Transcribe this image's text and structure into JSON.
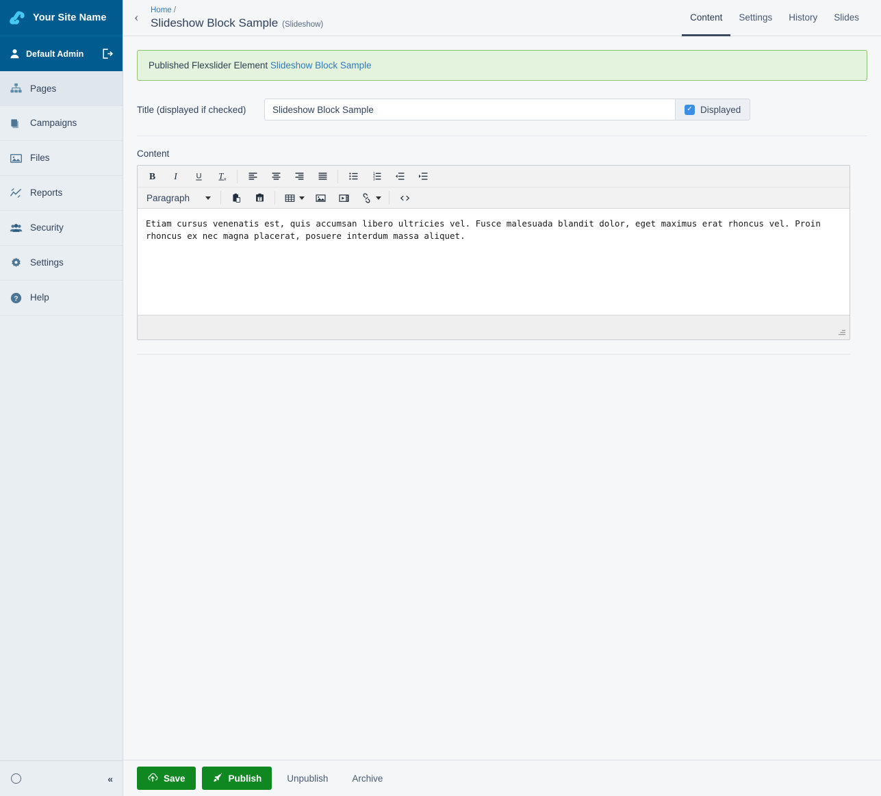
{
  "colors": {
    "brand_blue": "#005b8f",
    "sidebar_bg": "#e9eef2",
    "accent_link": "#337ab7",
    "success_bg": "#e3f3dd",
    "success_border": "#8cc474",
    "publish_green": "#0f8821",
    "checkbox_blue": "#3a8ee6"
  },
  "sidebar": {
    "brand_name": "Your Site Name",
    "logo_icon": "silverstripe-logo-icon",
    "profile": {
      "name": "Default Admin",
      "avatar_icon": "user-avatar-icon",
      "logout_icon": "logout-icon"
    },
    "items": [
      {
        "label": "Pages",
        "icon": "sitemap-icon",
        "active": true
      },
      {
        "label": "Campaigns",
        "icon": "campaigns-icon",
        "active": false
      },
      {
        "label": "Files",
        "icon": "image-icon",
        "active": false
      },
      {
        "label": "Reports",
        "icon": "chart-line-icon",
        "active": false
      },
      {
        "label": "Security",
        "icon": "users-icon",
        "active": false
      },
      {
        "label": "Settings",
        "icon": "gear-icon",
        "active": false
      },
      {
        "label": "Help",
        "icon": "question-circle-icon",
        "active": false
      }
    ],
    "footer": {
      "status_icon": "circle-icon",
      "collapse_label": "«"
    }
  },
  "topbar": {
    "back_icon": "chevron-left-icon",
    "breadcrumb_home": "Home",
    "breadcrumb_separator": "/",
    "page_title": "Slideshow Block Sample",
    "page_type": "(Slideshow)",
    "tabs": [
      {
        "label": "Content",
        "active": true
      },
      {
        "label": "Settings",
        "active": false
      },
      {
        "label": "History",
        "active": false
      },
      {
        "label": "Slides",
        "active": false
      }
    ]
  },
  "alert": {
    "text_before": "Published Flexslider Element ",
    "link_text": "Slideshow Block Sample"
  },
  "form": {
    "title_field": {
      "label": "Title (displayed if checked)",
      "value": "Slideshow Block Sample",
      "placeholder": ""
    },
    "displayed_checkbox": {
      "label": "Displayed",
      "checked": true,
      "check_glyph": "✓"
    },
    "content_label": "Content"
  },
  "editor": {
    "format_select": "Paragraph",
    "toolbar_row1": [
      {
        "name": "bold-icon",
        "title": "Bold"
      },
      {
        "name": "italic-icon",
        "title": "Italic"
      },
      {
        "name": "underline-icon",
        "title": "Underline"
      },
      {
        "name": "remove-format-icon",
        "title": "Clear formatting"
      },
      {
        "name": "align-left-icon",
        "title": "Align left"
      },
      {
        "name": "align-center-icon",
        "title": "Align center"
      },
      {
        "name": "align-right-icon",
        "title": "Align right"
      },
      {
        "name": "align-justify-icon",
        "title": "Justify"
      },
      {
        "name": "bullet-list-icon",
        "title": "Bullet list"
      },
      {
        "name": "numbered-list-icon",
        "title": "Numbered list"
      },
      {
        "name": "outdent-icon",
        "title": "Decrease indent"
      },
      {
        "name": "indent-icon",
        "title": "Increase indent"
      }
    ],
    "toolbar_row2": [
      {
        "name": "paste-icon",
        "title": "Paste"
      },
      {
        "name": "paste-as-text-icon",
        "title": "Paste as text"
      },
      {
        "name": "table-icon",
        "title": "Table"
      },
      {
        "name": "insert-image-icon",
        "title": "Insert image"
      },
      {
        "name": "insert-media-icon",
        "title": "Insert media"
      },
      {
        "name": "insert-link-icon",
        "title": "Insert link"
      },
      {
        "name": "source-code-icon",
        "title": "Source code"
      }
    ],
    "body_text": "Etiam cursus venenatis est, quis accumsan libero ultricies vel. Fusce malesuada blandit dolor, eget maximus erat rhoncus vel. Proin rhoncus ex nec magna placerat, posuere interdum massa aliquet.",
    "status_text": "",
    "resize_handle_icon": "resize-grip-icon"
  },
  "actions": {
    "save": {
      "label": "Save",
      "icon": "cloud-upload-icon"
    },
    "publish": {
      "label": "Publish",
      "icon": "rocket-icon"
    },
    "unpublish": {
      "label": "Unpublish"
    },
    "archive": {
      "label": "Archive"
    }
  }
}
